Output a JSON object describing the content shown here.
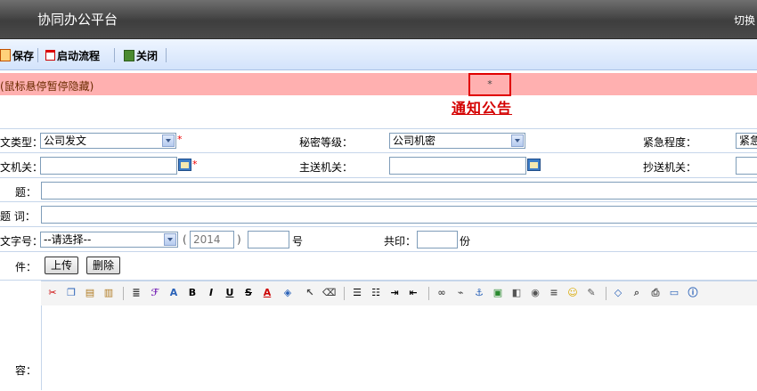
{
  "header": {
    "app_title": "协同办公平台",
    "switch_label": "切换"
  },
  "toolbar": {
    "save": "保存",
    "start_flow": "启动流程",
    "close": "关闭"
  },
  "notice": {
    "hint": "(鼠标悬停暂停隐藏)",
    "marker": "*"
  },
  "document": {
    "title": "通知公告"
  },
  "form": {
    "doc_type_label": "文类型：",
    "doc_type_value": "公司发文",
    "secret_label": "秘密等级：",
    "secret_value": "公司机密",
    "urgency_label": "紧急程度：",
    "urgency_value": "紧急",
    "issuer_label": "文机关：",
    "main_recipient_label": "主送机关：",
    "cc_label": "抄送机关：",
    "subject_label": "题：",
    "keywords_label": "题 词：",
    "doc_number_label": "文字号：",
    "doc_number_select": "--请选择--",
    "open_paren": "(",
    "year_value": "2014",
    "close_paren": ")",
    "number_suffix": "号",
    "copies_label": "共印：",
    "copies_suffix": "份",
    "attachment_label": "件：",
    "upload_button": "上传",
    "delete_button": "删除",
    "content_label": "容：",
    "required_mark": "*"
  }
}
